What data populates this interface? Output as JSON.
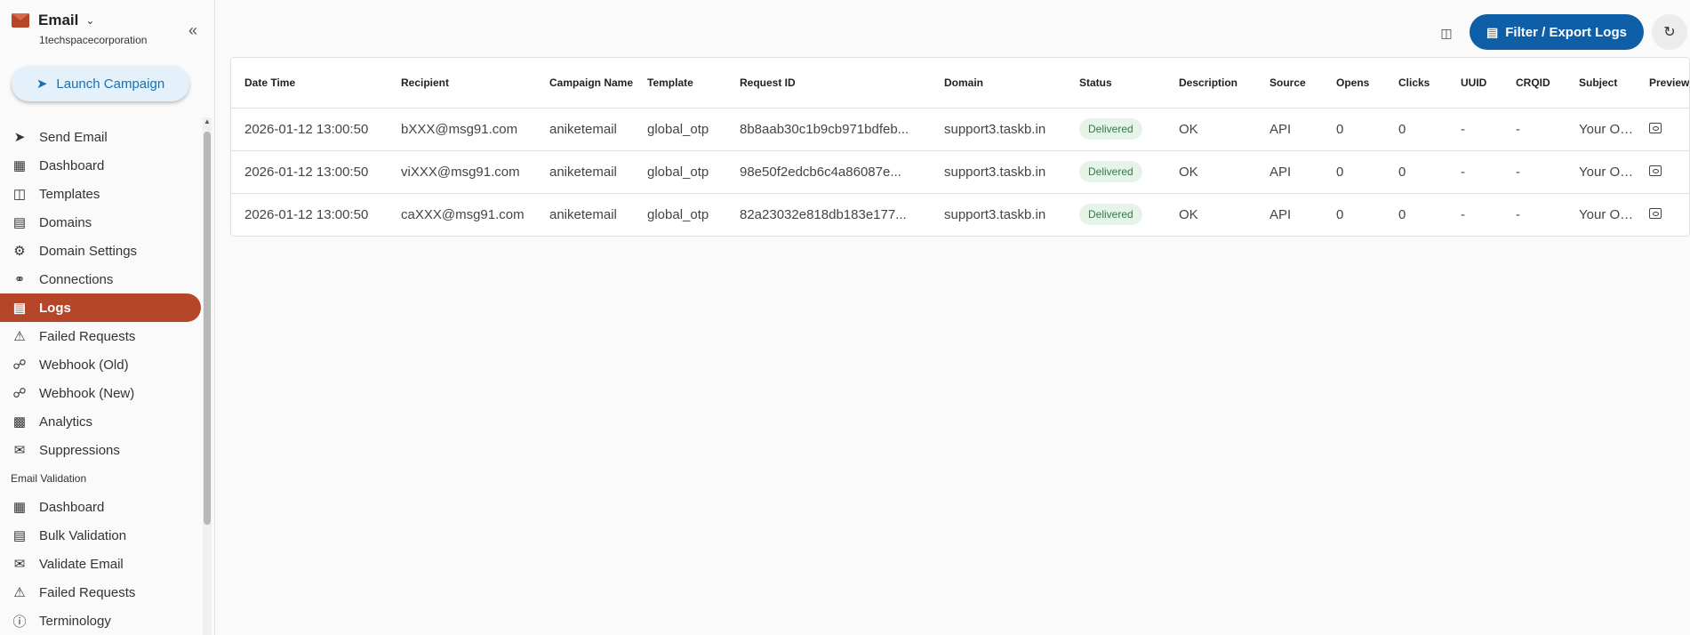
{
  "sidebar": {
    "app_name": "Email",
    "org_name": "1techspacecorporation",
    "launch_label": "Launch Campaign",
    "items": [
      {
        "label": "Send Email",
        "icon": "send-icon"
      },
      {
        "label": "Dashboard",
        "icon": "dashboard-icon"
      },
      {
        "label": "Templates",
        "icon": "templates-icon"
      },
      {
        "label": "Domains",
        "icon": "domains-icon"
      },
      {
        "label": "Domain Settings",
        "icon": "gear-icon"
      },
      {
        "label": "Connections",
        "icon": "plug-icon"
      },
      {
        "label": "Logs",
        "icon": "document-icon",
        "active": true
      },
      {
        "label": "Failed Requests",
        "icon": "warning-icon"
      },
      {
        "label": "Webhook (Old)",
        "icon": "webhook-icon"
      },
      {
        "label": "Webhook (New)",
        "icon": "webhook-icon"
      },
      {
        "label": "Analytics",
        "icon": "chart-icon"
      },
      {
        "label": "Suppressions",
        "icon": "mail-block-icon"
      }
    ],
    "section_label": "Email Validation",
    "validation_items": [
      {
        "label": "Dashboard",
        "icon": "dashboard-icon"
      },
      {
        "label": "Bulk Validation",
        "icon": "list-icon"
      },
      {
        "label": "Validate Email",
        "icon": "mail-icon"
      },
      {
        "label": "Failed Requests",
        "icon": "warning-icon"
      },
      {
        "label": "Terminology",
        "icon": "info-icon"
      }
    ]
  },
  "toolbar": {
    "filter_label": "Filter / Export Logs"
  },
  "table": {
    "headers": [
      "Date Time",
      "Recipient",
      "Campaign Name",
      "Template",
      "Request ID",
      "Domain",
      "Status",
      "Description",
      "Source",
      "Opens",
      "Clicks",
      "UUID",
      "CRQID",
      "Subject",
      "Preview"
    ],
    "rows": [
      [
        "2026-01-12 13:00:50",
        "bXXX@msg91.com",
        "aniketemail",
        "global_otp",
        "8b8aab30c1b9cb971bdfeb...",
        "support3.taskb.in",
        "Delivered",
        "OK",
        "API",
        "0",
        "0",
        "-",
        "-",
        "Your OTP"
      ],
      [
        "2026-01-12 13:00:50",
        "viXXX@msg91.com",
        "aniketemail",
        "global_otp",
        "98e50f2edcb6c4a86087e...",
        "support3.taskb.in",
        "Delivered",
        "OK",
        "API",
        "0",
        "0",
        "-",
        "-",
        "Your OTP"
      ],
      [
        "2026-01-12 13:00:50",
        "caXXX@msg91.com",
        "aniketemail",
        "global_otp",
        "82a23032e818db183e177...",
        "support3.taskb.in",
        "Delivered",
        "OK",
        "API",
        "0",
        "0",
        "-",
        "-",
        "Your OTP"
      ]
    ]
  },
  "colors": {
    "accent": "#b5462a",
    "primary": "#0f5fa8",
    "status_delivered_bg": "#e5f3e8",
    "status_delivered_text": "#2e7d43"
  }
}
